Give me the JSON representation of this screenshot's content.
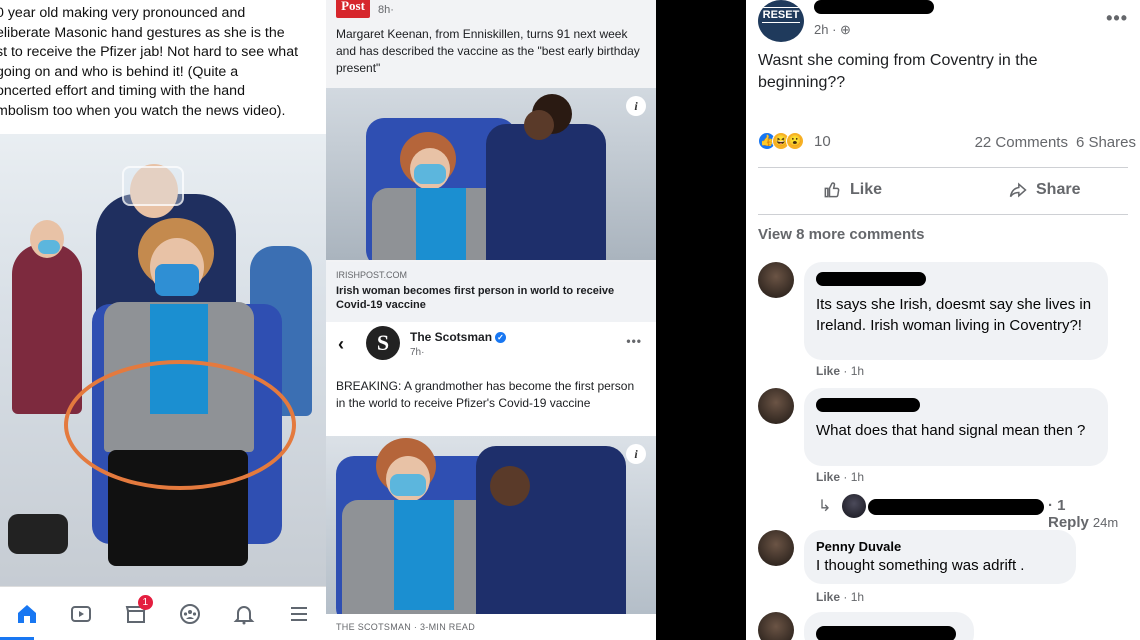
{
  "left": {
    "post_text": "0 year old making very pronounced and\neliberate Masonic hand gestures as she is the\nst to receive the Pfizer jab! Not hard to see what\ngoing on and who is behind it! (Quite a\noncerted effort and timing with the hand\nmbolism too when you watch the news video).",
    "nav": {
      "home": "home-icon",
      "video": "video-icon",
      "marketplace": "marketplace-icon",
      "marketplace_badge": "1",
      "groups": "groups-icon",
      "notifications": "bell-icon",
      "menu": "menu-icon"
    },
    "accent_color": "#e47a3e"
  },
  "middle": {
    "top_post": {
      "logo": "Post",
      "time": "8h·",
      "text": "Margaret Keenan, from Enniskillen, turns 91 next week and has described the vaccine as the \"best early birthday present\"",
      "link_source": "IRISHPOST.COM",
      "link_title": "Irish woman becomes first person in world to receive Covid-19 vaccine"
    },
    "scotsman_post": {
      "back": "‹",
      "logo": "S",
      "page_name": "The Scotsman",
      "time": "7h·",
      "text": "BREAKING: A grandmother has become the first person in the world to receive Pfizer's Covid-19 vaccine",
      "footer": "THE SCOTSMAN · 3-MIN READ"
    }
  },
  "right": {
    "page_avatar_text": "RESET",
    "time": "2h ·",
    "body": "Wasnt she coming from Coventry in the beginning??",
    "reaction_count": "10",
    "comments_count": "22 Comments",
    "shares_count": "6 Shares",
    "like_label": "Like",
    "share_label": "Share",
    "view_more": "View 8 more comments",
    "comments": [
      {
        "name": "",
        "text": "Its says she Irish, doesmt say she lives in Ireland. Irish woman living in Coventry?!",
        "like": "Like",
        "time": "· 1h"
      },
      {
        "name": "",
        "text": "What does that hand signal mean then ?",
        "like": "Like",
        "time": "· 1h"
      },
      {
        "name": "Penny Duvale",
        "text": "I thought something was adrift .",
        "like": "Like",
        "time": "· 1h"
      }
    ],
    "reply_label": "· 1 Reply",
    "reply_time": "24m",
    "brand_color": "#1877f2"
  }
}
